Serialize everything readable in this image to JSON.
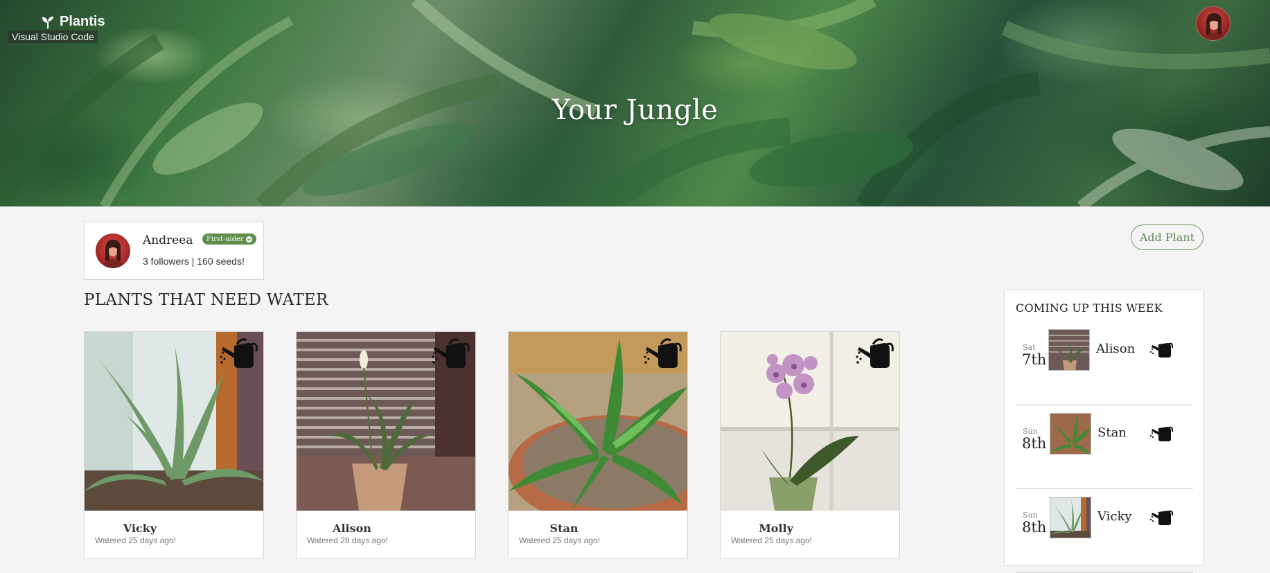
{
  "header": {
    "brand": "Plantis",
    "brand_icon": "sprout-icon",
    "tooltip": "Visual Studio Code",
    "hero_title": "Your Jungle",
    "avatar_icon": "user-avatar"
  },
  "profile": {
    "name": "Andreea",
    "badge": "First-aider",
    "stats": "3 followers | 160 seeds!"
  },
  "actions": {
    "add_plant": "Add Plant"
  },
  "section": {
    "title": "PLANTS THAT NEED WATER"
  },
  "plants": [
    {
      "name": "Vicky",
      "watered": "Watered 25 days ago!",
      "icon": "watering-can-icon"
    },
    {
      "name": "Alison",
      "watered": "Watered 28 days ago!",
      "icon": "watering-can-icon"
    },
    {
      "name": "Stan",
      "watered": "Watered 25 days ago!",
      "icon": "watering-can-icon"
    },
    {
      "name": "Molly",
      "watered": "Watered 25 days ago!",
      "icon": "watering-can-icon"
    }
  ],
  "schedule": {
    "title": "COMING UP THIS WEEK",
    "items": [
      {
        "day": "Sat",
        "date": "7th",
        "name": "Alison"
      },
      {
        "day": "Sun",
        "date": "8th",
        "name": "Stan"
      },
      {
        "day": "Sun",
        "date": "8th",
        "name": "Vicky"
      }
    ]
  },
  "colors": {
    "accent": "#5f8d4e",
    "background": "#f4f4f4",
    "card": "#ffffff"
  }
}
